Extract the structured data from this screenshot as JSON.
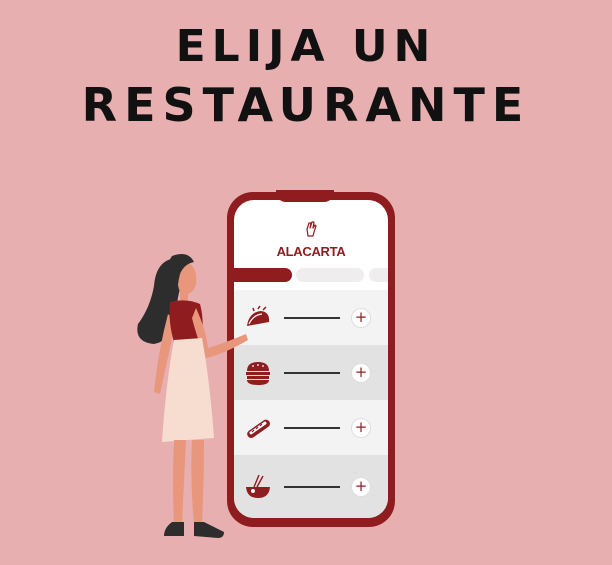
{
  "headline": {
    "line1": "ELIJA UN",
    "line2": "RESTAURANTE"
  },
  "colors": {
    "background": "#e8afb0",
    "brand": "#8f1c1f",
    "row_light": "#f4f3f3",
    "row_dark": "#e2e2e2"
  },
  "app": {
    "logo_icon": "hand-sign-icon",
    "name": "ALACARTA",
    "tabs": [
      "",
      "",
      ""
    ],
    "menu": [
      {
        "icon": "taco-icon",
        "add_label": "+"
      },
      {
        "icon": "burger-icon",
        "add_label": "+"
      },
      {
        "icon": "hotdog-icon",
        "add_label": "+"
      },
      {
        "icon": "ramen-bowl-icon",
        "add_label": "+"
      }
    ]
  }
}
